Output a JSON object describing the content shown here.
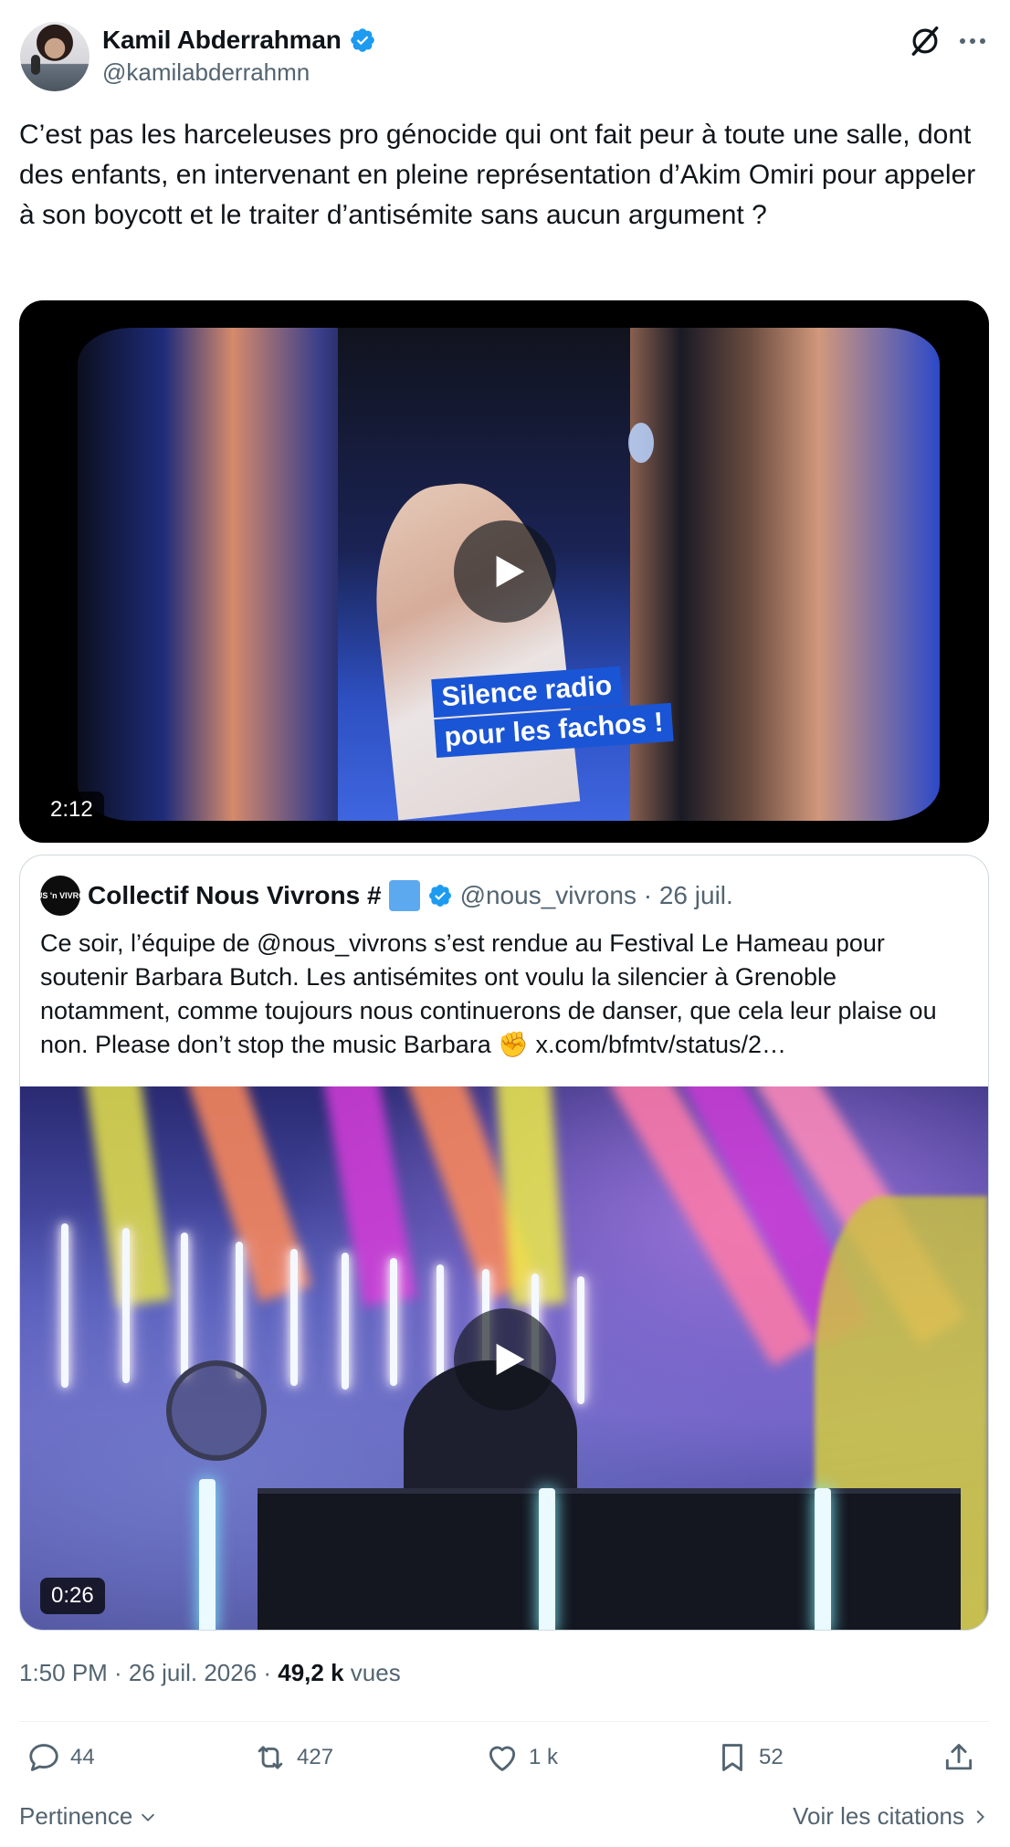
{
  "author": {
    "display_name": "Kamil Abderrahman",
    "handle": "@kamilabderrahmn"
  },
  "tweet": {
    "text": "C’est pas les harceleuses pro génocide qui ont fait peur à toute une salle, dont des enfants, en intervenant en pleine représentation d’Akim Omiri pour appeler à son boycott et le traiter d’antisémite sans aucun argument ?",
    "video": {
      "duration": "2:12",
      "caption_line1": "Silence radio",
      "caption_line2": "pour les fachos !"
    }
  },
  "quote": {
    "avatar_text": "NOUS 'n VIVRONS",
    "name": "Collectif Nous Vivrons #",
    "meta": "@nous_vivrons · 26 juil.",
    "text": "Ce soir, l’équipe de @nous_vivrons s’est rendue au Festival Le Hameau pour soutenir Barbara Butch. Les antisémites ont voulu la silencier à Grenoble notamment, comme toujours nous continuerons de danser, que cela leur plaise ou non. Please don’t stop the music Barbara ✊",
    "link": "x.com/bfmtv/status/2…",
    "video": {
      "duration": "0:26"
    }
  },
  "meta": {
    "time_date": "1:50 PM · 26 juil. 2026 · ",
    "views_count": "49,2 k",
    "views_label": "vues"
  },
  "actions": {
    "replies": "44",
    "reposts": "427",
    "likes": "1 k",
    "bookmarks": "52"
  },
  "footer": {
    "sort_label": "Pertinence",
    "quotes_link": "Voir les citations"
  },
  "colors": {
    "verified": "#1d9bf0",
    "secondary_text": "#536471",
    "border": "#cfd9de"
  },
  "icons": [
    "verified-badge-icon",
    "grok-icon",
    "more-icon",
    "play-icon",
    "reply-icon",
    "repost-icon",
    "like-icon",
    "bookmark-icon",
    "share-icon",
    "chevron-down-icon",
    "chevron-right-icon"
  ]
}
